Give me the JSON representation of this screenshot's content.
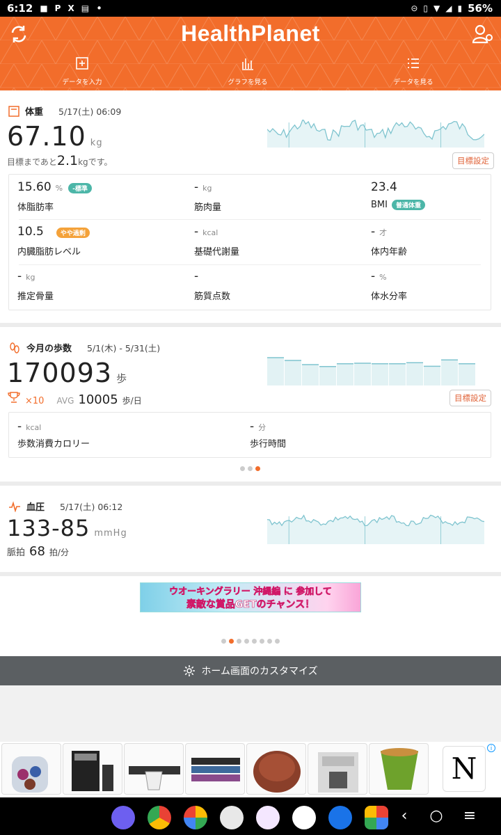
{
  "status_bar": {
    "time": "6:12",
    "dot": "•",
    "battery": "56%"
  },
  "header": {
    "logo": "HealthPlanet",
    "tabs": [
      {
        "label": "データを入力",
        "icon": "plus-square-icon"
      },
      {
        "label": "グラフを見る",
        "icon": "bar-chart-icon"
      },
      {
        "label": "データを見る",
        "icon": "list-icon"
      }
    ]
  },
  "weight": {
    "title": "体重",
    "date": "5/17(土) 06:09",
    "value": "67.10",
    "unit": "kg",
    "goal_prefix": "目標まであと",
    "goal_value": "2.1",
    "goal_unit": "kg",
    "goal_suffix": "です。",
    "goal_button": "目標設定",
    "metrics": [
      {
        "value": "15.60",
        "unit": "%",
        "label": "体脂肪率",
        "badge": "-標準",
        "badge_color": "#4cb6a8"
      },
      {
        "value": "-",
        "unit": "kg",
        "label": "筋肉量",
        "badge": "",
        "badge_color": ""
      },
      {
        "value": "23.4",
        "unit": "",
        "label": "BMI",
        "badge": "普通体重",
        "badge_color": "#4cb6a8"
      },
      {
        "value": "10.5",
        "unit": "",
        "label": "内臓脂肪レベル",
        "badge": "やや過剰",
        "badge_color": "#f4a23a"
      },
      {
        "value": "-",
        "unit": "kcal",
        "label": "基礎代謝量",
        "badge": "",
        "badge_color": ""
      },
      {
        "value": "-",
        "unit": "才",
        "label": "体内年齢",
        "badge": "",
        "badge_color": ""
      },
      {
        "value": "-",
        "unit": "kg",
        "label": "推定骨量",
        "badge": "",
        "badge_color": ""
      },
      {
        "value": "-",
        "unit": "",
        "label": "筋質点数",
        "badge": "",
        "badge_color": ""
      },
      {
        "value": "-",
        "unit": "%",
        "label": "体水分率",
        "badge": "",
        "badge_color": ""
      }
    ]
  },
  "steps": {
    "title": "今月の歩数",
    "period": "5/1(木) - 5/31(土)",
    "value": "170093",
    "unit": "歩",
    "trophy": "×10",
    "avg_label": "AVG",
    "avg_value": "10005",
    "avg_unit": "歩/日",
    "goal_button": "目標設定",
    "metrics": [
      {
        "value": "-",
        "unit": "kcal",
        "label": "歩数消費カロリー"
      },
      {
        "value": "-",
        "unit": "分",
        "label": "歩行時間"
      }
    ],
    "bars": [
      1.0,
      0.9,
      0.75,
      0.68,
      0.78,
      0.8,
      0.78,
      0.78,
      0.82,
      0.69,
      0.92,
      0.78
    ]
  },
  "bp": {
    "title": "血圧",
    "date": "5/17(土) 06:12",
    "value": "133-85",
    "unit": "mmHg",
    "pulse_label": "脈拍",
    "pulse_value": "68",
    "pulse_unit": "拍/分"
  },
  "banner": {
    "line1": "ウオーキングラリー 沖縄編 に 参加して",
    "line2": "素敵な賞品GETのチャンス！"
  },
  "customize": {
    "label": "ホーム画面のカスタマイズ"
  },
  "ad": {
    "brand": "N",
    "info": "i"
  },
  "colors": {
    "accent": "#f26d2b",
    "teal": "#4cb6a8",
    "chart_line": "#7fc4cf"
  }
}
